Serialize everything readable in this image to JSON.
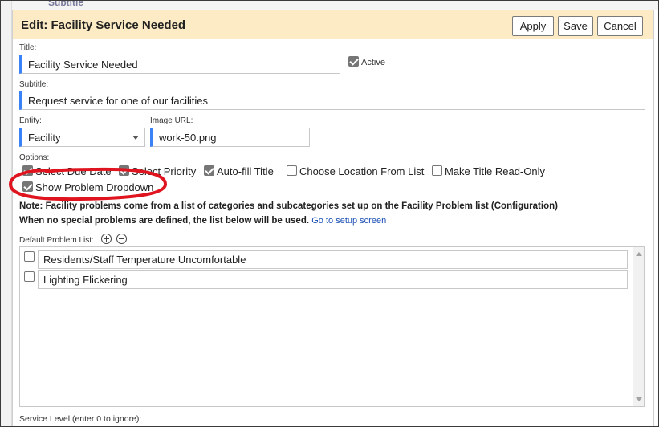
{
  "background": {
    "subtitle_peek": "Subtitle"
  },
  "dialog": {
    "title": "Edit: Facility Service Needed",
    "buttons": {
      "apply": "Apply",
      "save": "Save",
      "cancel": "Cancel"
    }
  },
  "form": {
    "title_label": "Title:",
    "title_value": "Facility Service Needed",
    "active_label": "Active",
    "active_checked": true,
    "subtitle_label": "Subtitle:",
    "subtitle_value": "Request service for one of our facilities",
    "entity_label": "Entity:",
    "entity_value": "Facility",
    "image_url_label": "Image URL:",
    "image_url_value": "work-50.png",
    "options_label": "Options:",
    "options": [
      {
        "label": "Select Due Date",
        "checked": true
      },
      {
        "label": "Select Priority",
        "checked": true
      },
      {
        "label": "Auto-fill Title",
        "checked": true
      },
      {
        "label": "Choose Location From List",
        "checked": false
      },
      {
        "label": "Make Title Read-Only",
        "checked": false
      },
      {
        "label": "Show Problem Dropdown",
        "checked": true
      }
    ],
    "note_line1": "Note: Facility problems come from a list of categories and subcategories set up on the Facility Problem list (Configuration)",
    "note_line2": "When no special problems are defined, the list below will be used.",
    "setup_link": "Go to setup screen",
    "problem_list_label": "Default Problem List:",
    "problem_list": [
      {
        "text": "Residents/Staff Temperature Uncomfortable",
        "checked": false
      },
      {
        "text": "Lighting Flickering",
        "checked": false
      }
    ],
    "service_level_label": "Service Level (enter 0 to ignore):"
  },
  "colors": {
    "titlebar_bg": "#fcebc4",
    "field_accent": "#3b82f6",
    "annotation": "#e0141e",
    "link": "#1a4fb5"
  }
}
